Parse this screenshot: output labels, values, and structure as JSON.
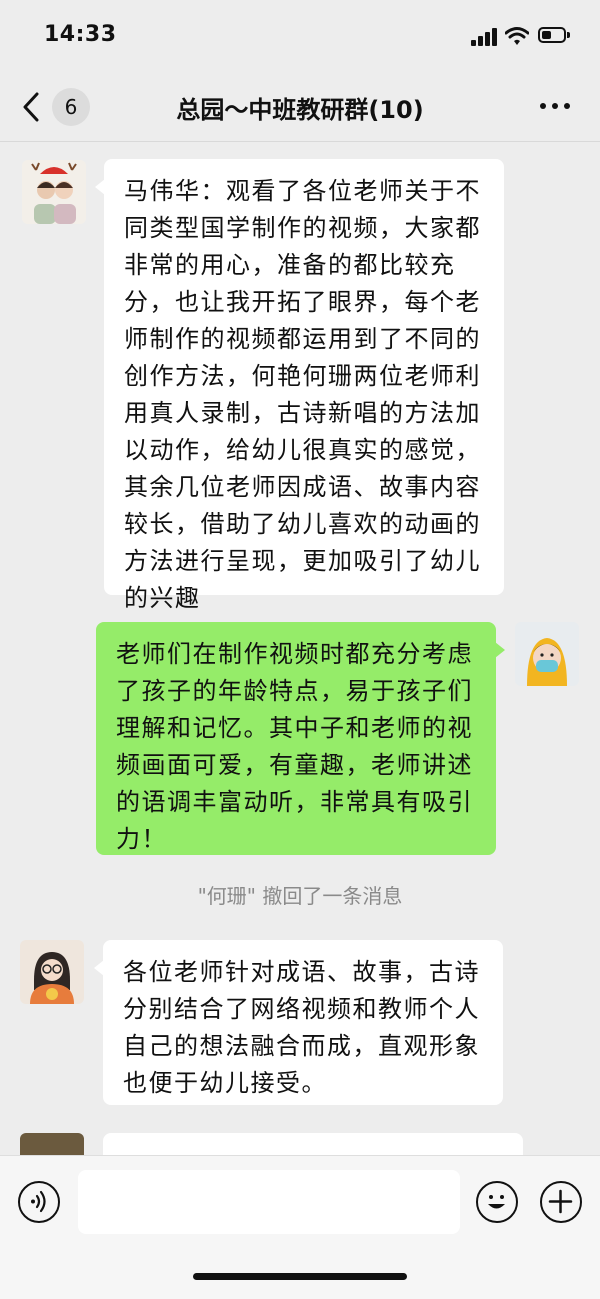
{
  "status_bar": {
    "time": "14:33"
  },
  "nav": {
    "unread_count": "6",
    "title": "总园～中班教研群(10)"
  },
  "messages": [
    {
      "side": "left",
      "text": "马伟华：观看了各位老师关于不同类型国学制作的视频，大家都非常的用心，准备的都比较充分，也让我开拓了眼界，每个老师制作的视频都运用到了不同的创作方法，何艳何珊两位老师利用真人录制，古诗新唱的方法加以动作，给幼儿很真实的感觉，其余几位老师因成语、故事内容较长，借助了幼儿喜欢的动画的方法进行呈现，更加吸引了幼儿的兴趣"
    },
    {
      "side": "right",
      "text": "老师们在制作视频时都充分考虑了孩子的年龄特点，易于孩子们理解和记忆。其中子和老师的视频画面可爱，有童趣，老师讲述的语调丰富动听，非常具有吸引力！"
    },
    {
      "side": "left",
      "text": "各位老师针对成语、故事，古诗分别结合了网络视频和教师个人自己的想法融合而成，直观形象也便于幼儿接受。"
    }
  ],
  "system_note": "\"何珊\" 撤回了一条消息",
  "colors": {
    "sent_bubble": "#95ec69",
    "received_bubble": "#ffffff",
    "background": "#ededed"
  }
}
